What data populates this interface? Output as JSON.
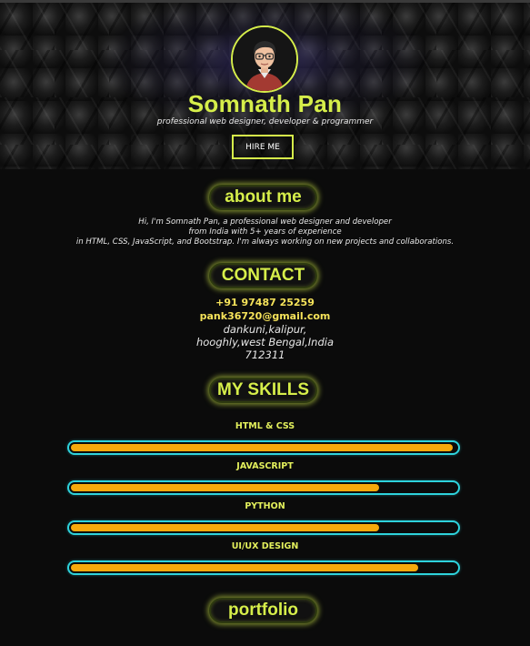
{
  "profile": {
    "name": "Somnath Pan",
    "tagline": "professional web designer, developer & programmer",
    "hire_label": "HIRE ME"
  },
  "about": {
    "heading": "about me",
    "lines": [
      "Hi, I'm Somnath Pan, a professional web designer and developer",
      "from India with 5+ years of experience",
      "in HTML, CSS, JavaScript, and Bootstrap. I'm always working on new projects and collaborations."
    ]
  },
  "contact": {
    "heading": "CONTACT",
    "phone": "+91 97487 25259",
    "email": "pank36720@gmail.com",
    "address": [
      "dankuni,kalipur,",
      "hooghly,west Bengal,India",
      "712311"
    ]
  },
  "skills": {
    "heading": "MY SKILLS",
    "items": [
      {
        "name": "HTML & CSS",
        "level": 0.99
      },
      {
        "name": "JAVASCRIPT",
        "level": 0.8
      },
      {
        "name": "PYTHON",
        "level": 0.8
      },
      {
        "name": "UI/UX DESIGN",
        "level": 0.9
      }
    ]
  },
  "portfolio": {
    "heading": "portfolio"
  },
  "colors": {
    "accent": "#d6ee4a",
    "bar_fill": "#f7a90b",
    "bar_border": "#2ed3dc",
    "background": "#0b0b0b"
  }
}
